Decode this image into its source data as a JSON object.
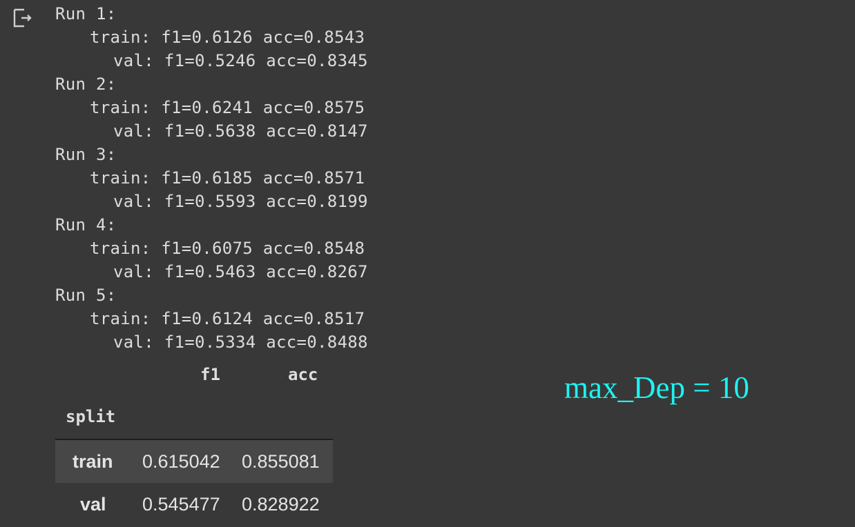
{
  "output_cell": {
    "icon": "output-redirect-icon",
    "runs": [
      {
        "label": "Run 1:",
        "train": "train: f1=0.6126 acc=0.8543",
        "val": "val: f1=0.5246 acc=0.8345"
      },
      {
        "label": "Run 2:",
        "train": "train: f1=0.6241 acc=0.8575",
        "val": "val: f1=0.5638 acc=0.8147"
      },
      {
        "label": "Run 3:",
        "train": "train: f1=0.6185 acc=0.8571",
        "val": "val: f1=0.5593 acc=0.8199"
      },
      {
        "label": "Run 4:",
        "train": "train: f1=0.6075 acc=0.8548",
        "val": "val: f1=0.5463 acc=0.8267"
      },
      {
        "label": "Run 5:",
        "train": "train: f1=0.6124 acc=0.8517",
        "val": "val: f1=0.5334 acc=0.8488"
      }
    ],
    "dataframe": {
      "columns": [
        "f1",
        "acc"
      ],
      "index_name": "split",
      "rows": [
        {
          "index": "train",
          "f1": "0.615042",
          "acc": "0.855081"
        },
        {
          "index": "val",
          "f1": "0.545477",
          "acc": "0.828922"
        }
      ]
    }
  },
  "annotation": {
    "text": "max_Dep = 10",
    "color": "#1ef2f2"
  },
  "theme": {
    "background": "#383838",
    "striped_row": "#474747"
  }
}
